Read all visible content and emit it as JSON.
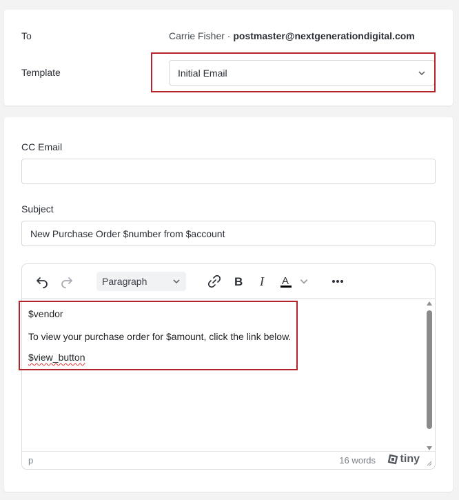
{
  "header": {
    "to_label": "To",
    "to_name": "Carrie Fisher · ",
    "to_email": "postmaster@nextgenerationdigital.com",
    "template_label": "Template",
    "template_value": "Initial Email"
  },
  "form": {
    "cc_label": "CC Email",
    "cc_value": "",
    "subject_label": "Subject",
    "subject_value": "New Purchase Order $number from $account"
  },
  "editor": {
    "toolbar": {
      "block_format": "Paragraph",
      "icons": [
        "undo-icon",
        "redo-icon",
        "link-icon",
        "bold-icon",
        "italic-icon",
        "text-color-icon",
        "more-icon"
      ]
    },
    "content": {
      "line1": "$vendor",
      "line2": "To view your purchase order for $amount, click the link below.",
      "line3": "$view_button"
    },
    "status": {
      "path": "p",
      "word_count": "16 words",
      "brand": "tiny"
    }
  },
  "colors": {
    "highlight": "#b4232a",
    "background": "#f3f3f4"
  }
}
